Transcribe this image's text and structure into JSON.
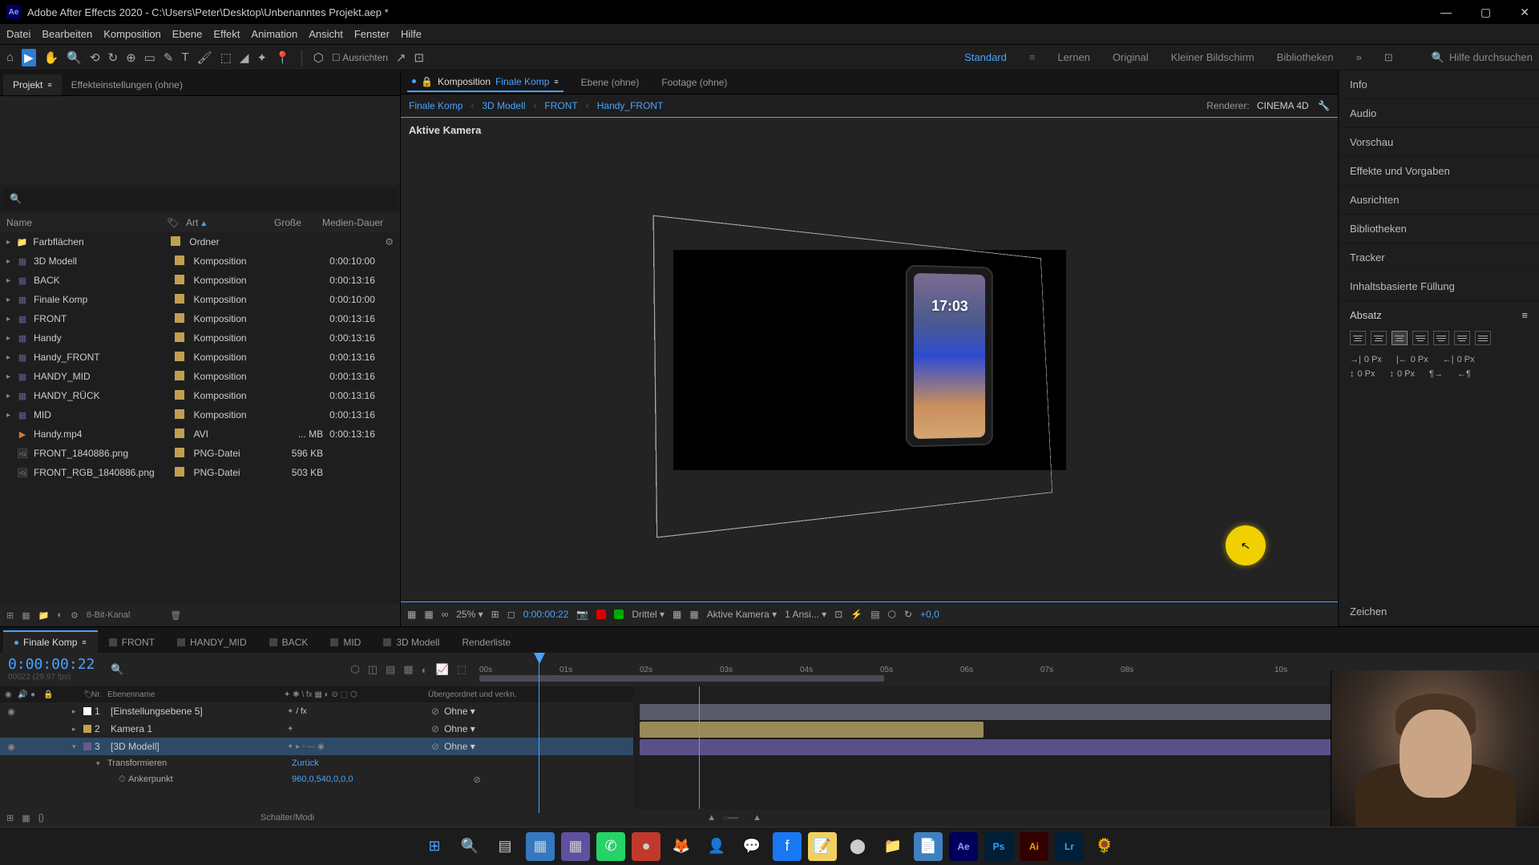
{
  "title": "Adobe After Effects 2020 - C:\\Users\\Peter\\Desktop\\Unbenanntes Projekt.aep *",
  "menu": [
    "Datei",
    "Bearbeiten",
    "Komposition",
    "Ebene",
    "Effekt",
    "Animation",
    "Ansicht",
    "Fenster",
    "Hilfe"
  ],
  "toolbar": {
    "align_label": "Ausrichten"
  },
  "workspaces": {
    "items": [
      "Standard",
      "Lernen",
      "Original",
      "Kleiner Bildschirm",
      "Bibliotheken"
    ],
    "active": "Standard",
    "search_placeholder": "Hilfe durchsuchen"
  },
  "project_panel": {
    "tabs": [
      "Projekt",
      "Effekteinstellungen (ohne)"
    ],
    "active_tab": "Projekt",
    "headers": {
      "name": "Name",
      "type": "Art",
      "size": "Große",
      "duration": "Medien-Dauer",
      "sort_col": "Art"
    },
    "rows": [
      {
        "expandable": true,
        "icon": "folder",
        "color": "#b09050",
        "name": "Farbflächen",
        "tag": "#c0a050",
        "type": "Ordner",
        "size": "",
        "dur": ""
      },
      {
        "expandable": true,
        "icon": "comp",
        "color": "#6a5a8f",
        "name": "3D Modell",
        "tag": "#c0a050",
        "type": "Komposition",
        "size": "",
        "dur": "0:00:10:00"
      },
      {
        "expandable": true,
        "icon": "comp",
        "color": "#6a5a8f",
        "name": "BACK",
        "tag": "#c0a050",
        "type": "Komposition",
        "size": "",
        "dur": "0:00:13:16"
      },
      {
        "expandable": true,
        "icon": "comp",
        "color": "#6a5a8f",
        "name": "Finale Komp",
        "tag": "#c0a050",
        "type": "Komposition",
        "size": "",
        "dur": "0:00:10:00"
      },
      {
        "expandable": true,
        "icon": "comp",
        "color": "#6a5a8f",
        "name": "FRONT",
        "tag": "#c0a050",
        "type": "Komposition",
        "size": "",
        "dur": "0:00:13:16"
      },
      {
        "expandable": true,
        "icon": "comp",
        "color": "#6a5a8f",
        "name": "Handy",
        "tag": "#c0a050",
        "type": "Komposition",
        "size": "",
        "dur": "0:00:13:16"
      },
      {
        "expandable": true,
        "icon": "comp",
        "color": "#6a5a8f",
        "name": "Handy_FRONT",
        "tag": "#c0a050",
        "type": "Komposition",
        "size": "",
        "dur": "0:00:13:16"
      },
      {
        "expandable": true,
        "icon": "comp",
        "color": "#6a5a8f",
        "name": "HANDY_MID",
        "tag": "#c0a050",
        "type": "Komposition",
        "size": "",
        "dur": "0:00:13:16"
      },
      {
        "expandable": true,
        "icon": "comp",
        "color": "#6a5a8f",
        "name": "HANDY_RÜCK",
        "tag": "#c0a050",
        "type": "Komposition",
        "size": "",
        "dur": "0:00:13:16"
      },
      {
        "expandable": true,
        "icon": "comp",
        "color": "#6a5a8f",
        "name": "MID",
        "tag": "#c0a050",
        "type": "Komposition",
        "size": "",
        "dur": "0:00:13:16"
      },
      {
        "expandable": false,
        "icon": "video",
        "color": "#d47a30",
        "name": "Handy.mp4",
        "tag": "#c0a050",
        "type": "AVI",
        "size": "... MB",
        "dur": "0:00:13:16"
      },
      {
        "expandable": false,
        "icon": "image",
        "color": "#888",
        "name": "FRONT_1840886.png",
        "tag": "#c0a050",
        "type": "PNG-Datei",
        "size": "596 KB",
        "dur": ""
      },
      {
        "expandable": false,
        "icon": "image",
        "color": "#888",
        "name": "FRONT_RGB_1840886.png",
        "tag": "#c0a050",
        "type": "PNG-Datei",
        "size": "503 KB",
        "dur": ""
      }
    ],
    "footer_depth": "8-Bit-Kanal"
  },
  "comp_panel": {
    "tabs": [
      {
        "label_prefix": "Komposition",
        "label": "Finale Komp",
        "active": true
      },
      {
        "label": "Ebene (ohne)"
      },
      {
        "label": "Footage (ohne)"
      }
    ],
    "breadcrumb": [
      "Finale Komp",
      "3D Modell",
      "FRONT",
      "Handy_FRONT"
    ],
    "renderer_label": "Renderer:",
    "renderer_value": "CINEMA 4D",
    "camera_label": "Aktive Kamera",
    "phone_time": "17:03",
    "footer": {
      "zoom": "25%",
      "timecode": "0:00:00:22",
      "grid_mode": "Drittel",
      "camera": "Aktive Kamera",
      "views": "1 Ansi...",
      "exposure": "+0,0"
    }
  },
  "right_panels": {
    "items": [
      "Info",
      "Audio",
      "Vorschau",
      "Effekte und Vorgaben",
      "Ausrichten",
      "Bibliotheken",
      "Tracker",
      "Inhaltsbasierte Füllung"
    ],
    "absatz": {
      "title": "Absatz",
      "indent": "0 Px"
    },
    "zeichen": "Zeichen"
  },
  "timeline": {
    "tabs": [
      "Finale Komp",
      "FRONT",
      "HANDY_MID",
      "BACK",
      "MID",
      "3D Modell",
      "Renderliste"
    ],
    "active_tab": "Finale Komp",
    "timecode": "0:00:00:22",
    "col_headers": {
      "nr": "Nr.",
      "name": "Ebenenname",
      "parent": "Übergeordnet und verkn."
    },
    "ticks": [
      "00s",
      "01s",
      "02s",
      "03s",
      "04s",
      "05s",
      "06s",
      "07s",
      "08s",
      "10s"
    ],
    "layers": [
      {
        "eye": true,
        "num": "1",
        "color": "#fff",
        "name": "[Einstellungsebene 5]",
        "parent": "Ohne",
        "selected": false,
        "fx": true
      },
      {
        "eye": false,
        "num": "2",
        "color": "#c0a050",
        "name": "Kamera 1",
        "parent": "Ohne",
        "selected": false
      },
      {
        "eye": true,
        "num": "3",
        "color": "#6a5a8f",
        "name": "[3D Modell]",
        "parent": "Ohne",
        "selected": true,
        "expanded": true
      }
    ],
    "transform_label": "Transformieren",
    "transform_reset": "Zurück",
    "anchor_label": "Ankerpunkt",
    "anchor_value": "960,0,540,0,0,0",
    "footer_label": "Schalter/Modi"
  }
}
